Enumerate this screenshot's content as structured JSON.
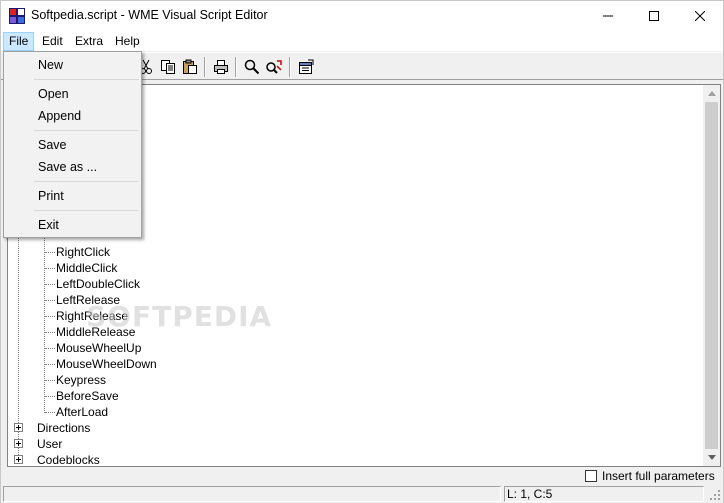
{
  "window": {
    "title": "Softpedia.script - WME Visual Script Editor"
  },
  "menubar": {
    "items": [
      "File",
      "Edit",
      "Extra",
      "Help"
    ]
  },
  "file_menu": {
    "items": [
      "New",
      "Open",
      "Append",
      "Save",
      "Save as ...",
      "Print",
      "Exit"
    ]
  },
  "tree": {
    "event_nodes": [
      "RightClick",
      "MiddleClick",
      "LeftDoubleClick",
      "LeftRelease",
      "RightRelease",
      "MiddleRelease",
      "MouseWheelUp",
      "MouseWheelDown",
      "Keypress",
      "BeforeSave",
      "AfterLoad"
    ],
    "root_nodes": [
      "Directions",
      "User",
      "Codeblocks"
    ]
  },
  "watermark": "SOFTPEDIA",
  "options": {
    "insert_full_parameters": "Insert full parameters",
    "insert_full_parameters_checked": false
  },
  "statusbar": {
    "position": "L: 1, C:5"
  },
  "icons": {
    "app": "wme-app-icon",
    "toolbar": [
      "cut-icon",
      "copy-icon",
      "paste-icon",
      "print-icon",
      "find-icon",
      "replace-icon",
      "properties-icon"
    ]
  },
  "colors": {
    "menu_highlight": "#cce8ff",
    "menu_highlight_border": "#99d1ff"
  }
}
